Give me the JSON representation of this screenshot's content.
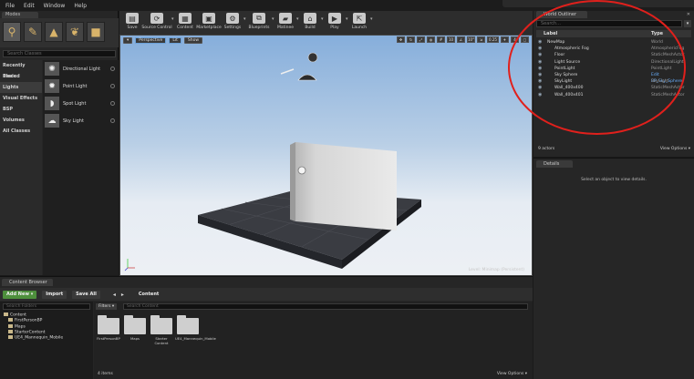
{
  "menu": [
    "File",
    "Edit",
    "Window",
    "Help"
  ],
  "titlebar": "",
  "modes": {
    "tab_label": "Modes",
    "search_placeholder": "Search Classes",
    "categories": [
      "Recently Placed",
      "Basic",
      "Lights",
      "Visual Effects",
      "BSP",
      "Volumes",
      "All Classes"
    ],
    "active_category": "Lights",
    "placeables": [
      "Directional Light",
      "Point Light",
      "Spot Light",
      "Sky Light"
    ]
  },
  "toolbar": {
    "buttons": [
      "Save",
      "Source Control",
      "Content",
      "Marketplace",
      "Settings",
      "Blueprints",
      "Matinee",
      "Build",
      "Play",
      "Launch"
    ]
  },
  "viewport": {
    "perspective": "Perspective",
    "lit": "Lit",
    "show": "Show",
    "right_values": [
      "10",
      "10°",
      "0.25",
      "4"
    ],
    "level_label": "Level: Minimap (Persistent)"
  },
  "outliner": {
    "tab_label": "World Outliner",
    "search_placeholder": "Search...",
    "col_label": "Label",
    "col_type": "Type",
    "rows": [
      {
        "label": "NewMap",
        "type": "World",
        "indent": 0
      },
      {
        "label": "Atmospheric Fog",
        "type": "AtmosphericFog",
        "indent": 1
      },
      {
        "label": "Floor",
        "type": "StaticMeshActor",
        "indent": 1
      },
      {
        "label": "Light Source",
        "type": "DirectionalLight",
        "indent": 1
      },
      {
        "label": "PointLight",
        "type": "PointLight",
        "indent": 1
      },
      {
        "label": "Sky Sphere",
        "type": "Edit BP_Sky_Sphere",
        "indent": 1,
        "link": true
      },
      {
        "label": "SkyLight",
        "type": "SkyLight",
        "indent": 1
      },
      {
        "label": "Wall_400x400",
        "type": "StaticMeshActor",
        "indent": 1
      },
      {
        "label": "Wall_400x401",
        "type": "StaticMeshActor",
        "indent": 1
      }
    ],
    "count": "9 actors",
    "view_options": "View Options ▾"
  },
  "details": {
    "tab_label": "Details",
    "empty_message": "Select an object to view details."
  },
  "content_browser": {
    "tab_label": "Content Browser",
    "add_new": "Add New ▾",
    "import": "Import",
    "save_all": "Save All",
    "path": "Content",
    "tree_search_placeholder": "Search Folders",
    "tree": [
      {
        "label": "Content",
        "indent": 0
      },
      {
        "label": "FirstPersonBP",
        "indent": 1
      },
      {
        "label": "Maps",
        "indent": 1
      },
      {
        "label": "StarterContent",
        "indent": 1
      },
      {
        "label": "UE4_Mannequin_Mobile",
        "indent": 1
      }
    ],
    "filters": "Filters ▾",
    "files_search_placeholder": "Search Content",
    "folders": [
      "FirstPersonBP",
      "Maps",
      "Starter Content",
      "UE4_Mannequin_Mobile"
    ],
    "count": "4 items",
    "view_options": "View Options ▾"
  },
  "colors": {
    "annotation": "#e0201c",
    "add_new": "#4d8f3c",
    "link": "#6ab0ff"
  }
}
